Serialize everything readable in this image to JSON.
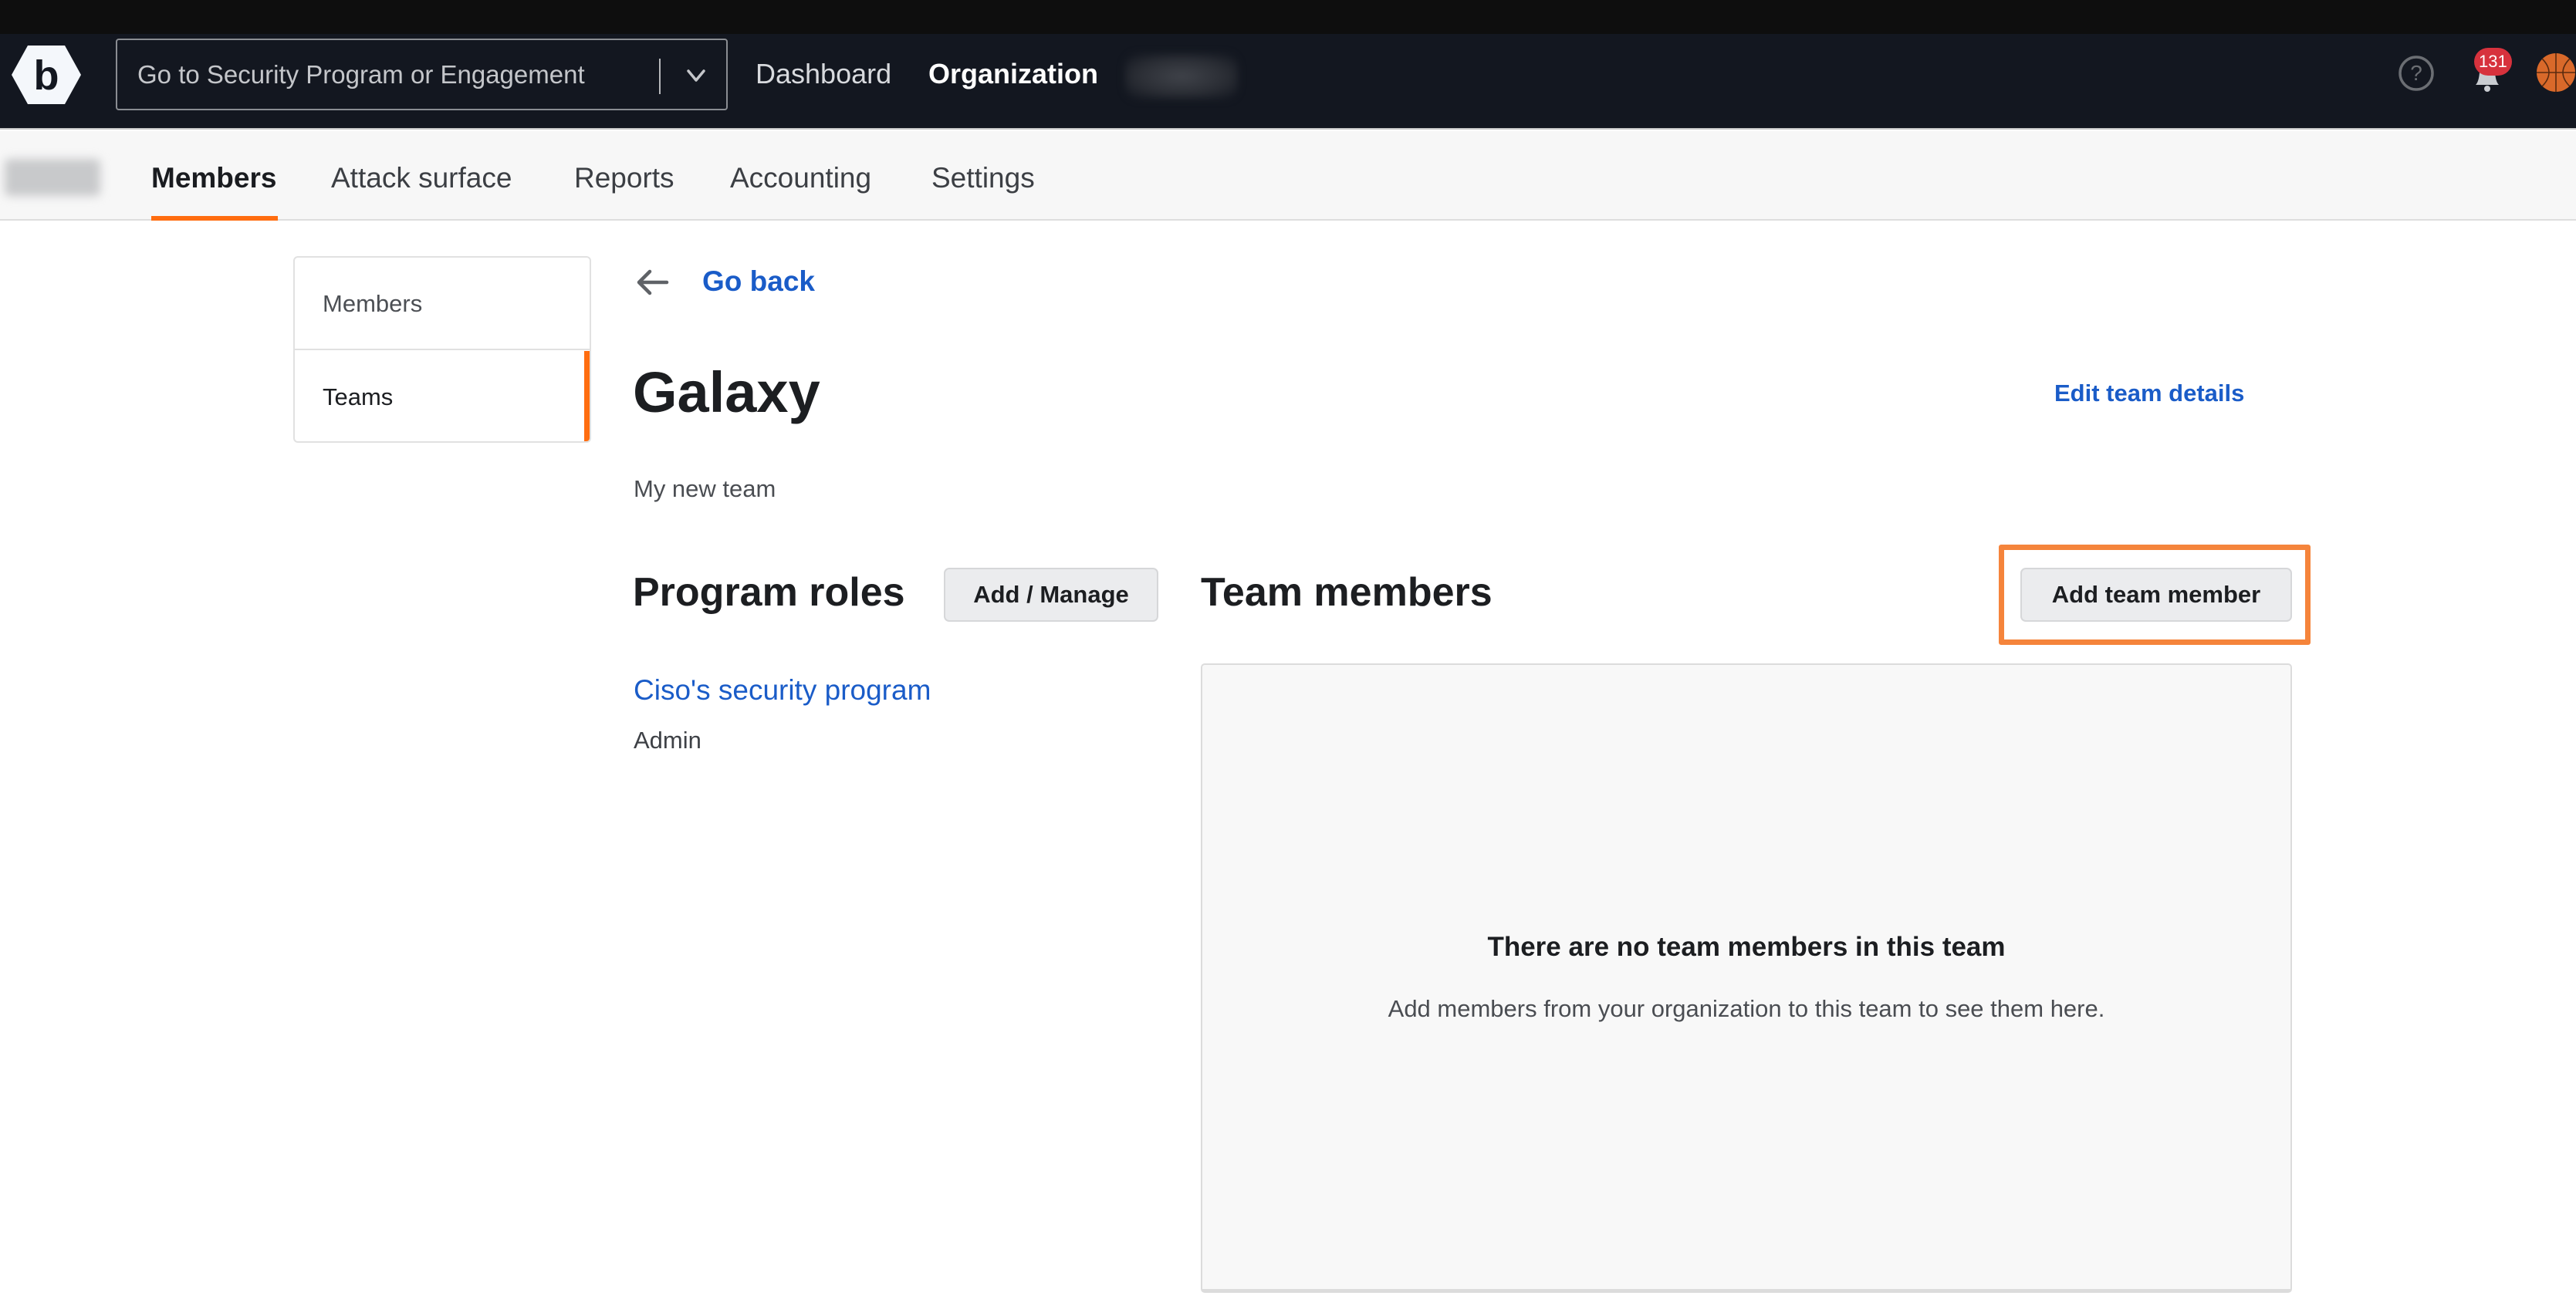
{
  "top_nav": {
    "logo_letter": "b",
    "program_select": {
      "placeholder": "Go to Security Program or Engagement",
      "value": ""
    },
    "links": [
      {
        "label": "Dashboard",
        "active": false
      },
      {
        "label": "Organization",
        "active": true
      }
    ],
    "blurred_org_name": "",
    "icons": {
      "help": "help-circle-icon",
      "notifications": "bell-icon",
      "avatar": "basketball-avatar"
    },
    "notification_count": "131"
  },
  "sub_nav": {
    "blurred_org_label": "",
    "tabs": [
      {
        "label": "Members",
        "active": true
      },
      {
        "label": "Attack surface",
        "active": false
      },
      {
        "label": "Reports",
        "active": false
      },
      {
        "label": "Accounting",
        "active": false
      },
      {
        "label": "Settings",
        "active": false
      }
    ]
  },
  "side_menu": {
    "items": [
      {
        "label": "Members",
        "active": false
      },
      {
        "label": "Teams",
        "active": true
      }
    ]
  },
  "team": {
    "go_back_label": "Go back",
    "name": "Galaxy",
    "description": "My new team",
    "edit_label": "Edit team details"
  },
  "program_roles": {
    "title": "Program roles",
    "manage_button": "Add / Manage",
    "roles": [
      {
        "program": "Ciso's security program",
        "role": "Admin"
      }
    ]
  },
  "team_members": {
    "title": "Team members",
    "add_button": "Add team member",
    "empty_title": "There are no team members in this team",
    "empty_description": "Add members from your organization to this team to see them here."
  },
  "colors": {
    "accent_orange": "#ff6d10",
    "highlight_orange": "#f5843b",
    "link_blue": "#1a5cc8",
    "nav_bg": "#131720",
    "badge_red": "#d7323d"
  }
}
